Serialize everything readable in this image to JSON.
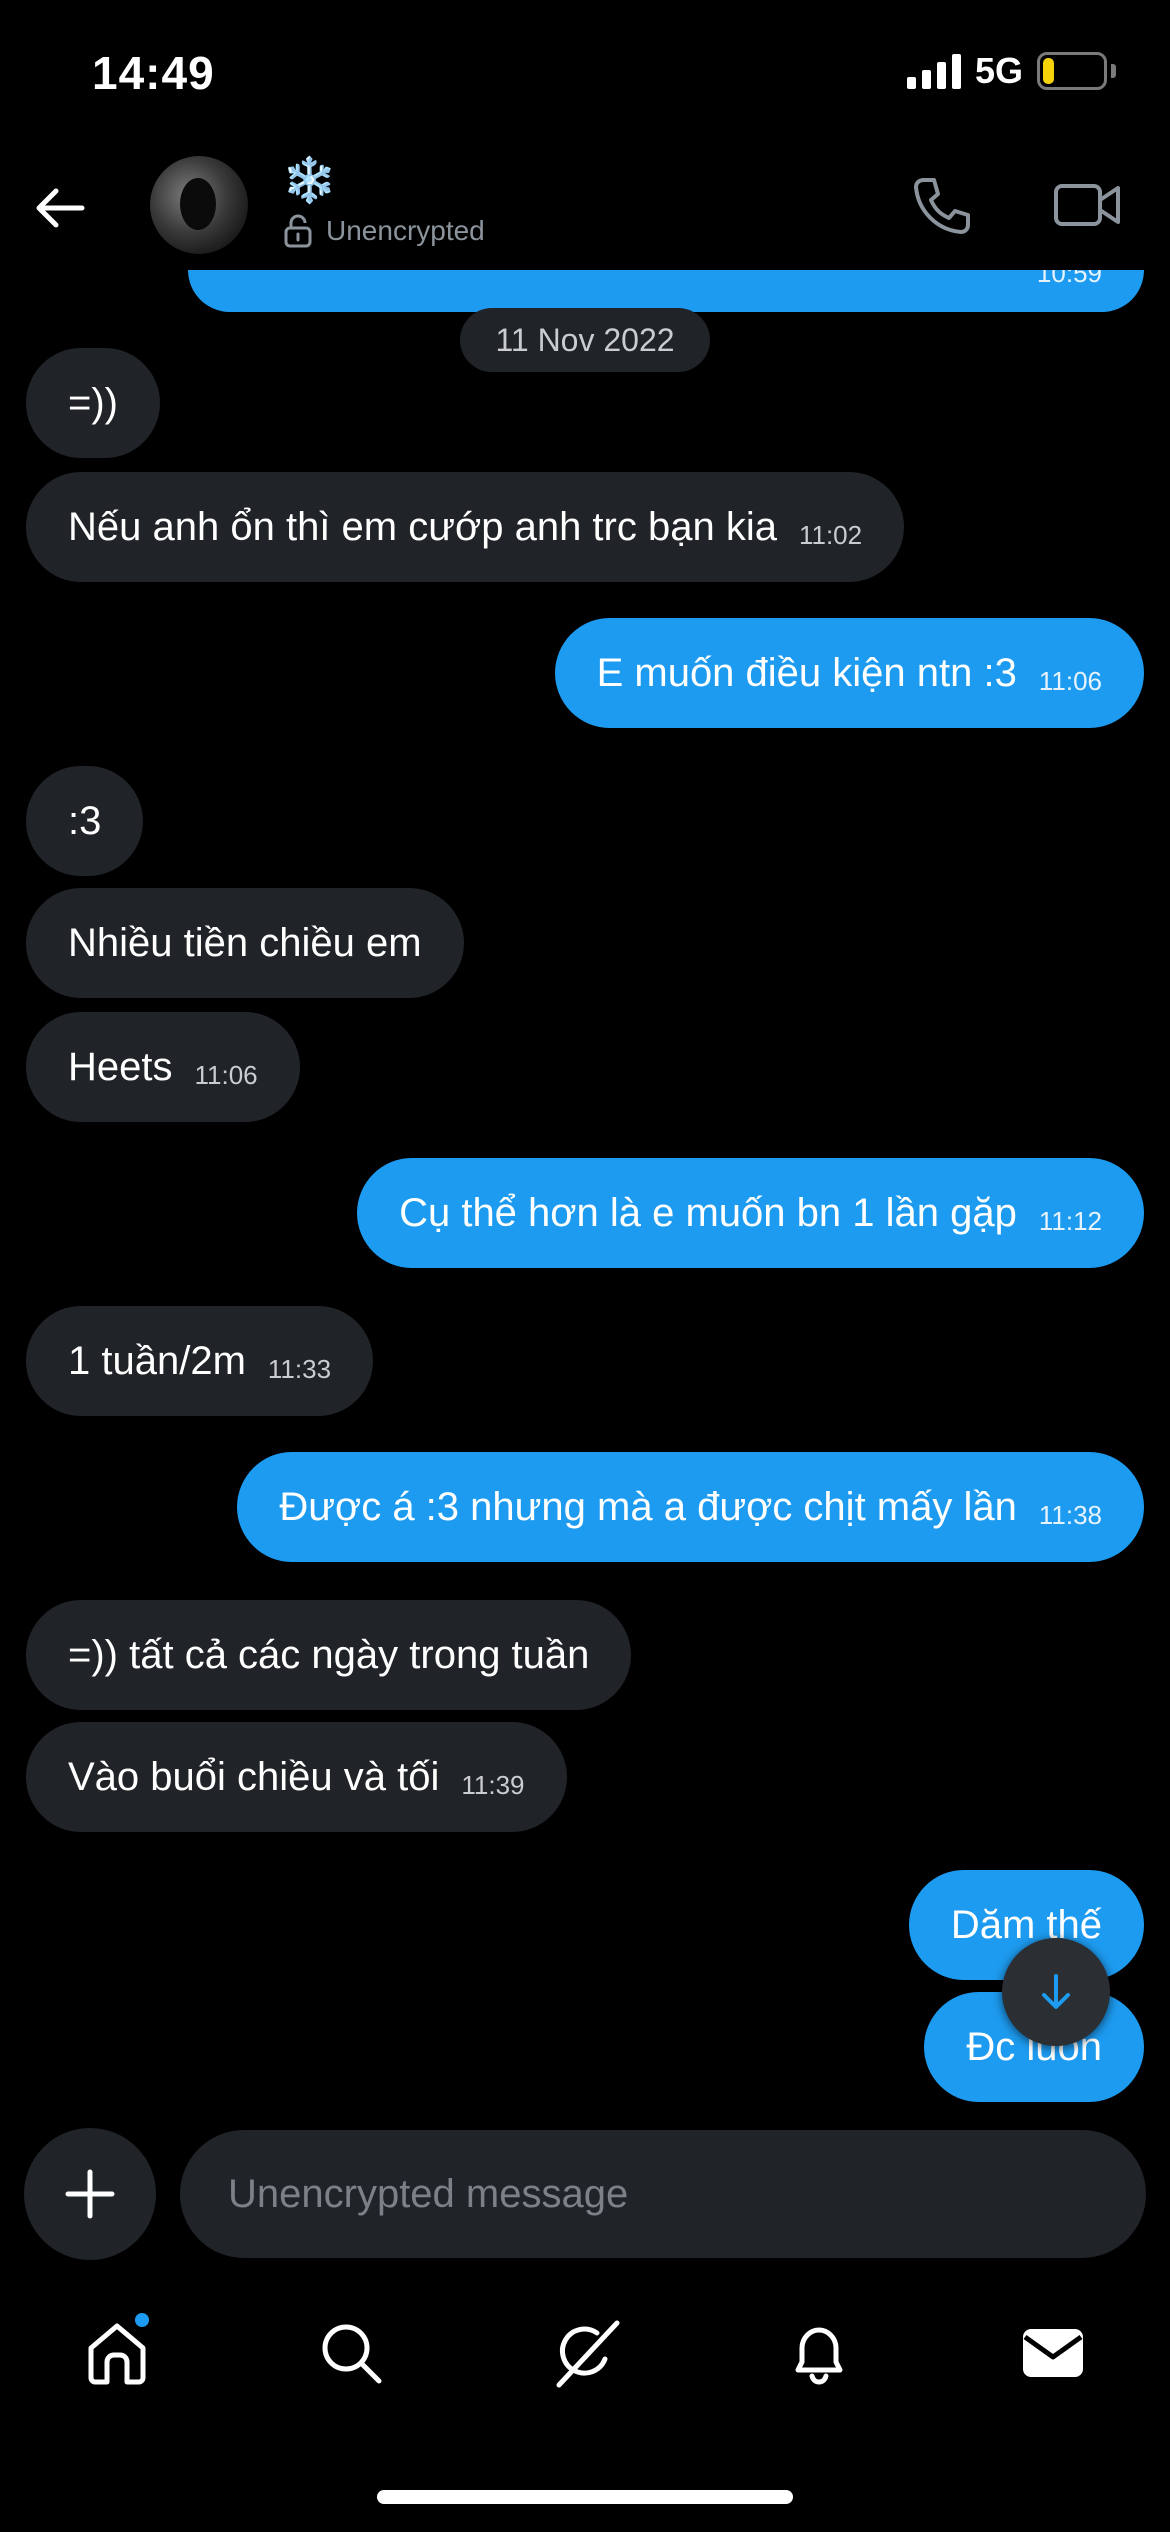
{
  "status_bar": {
    "time": "14:49",
    "network": "5G",
    "battery": "19",
    "battery_level": 0.19
  },
  "header": {
    "contact_name": "❄️",
    "encryption_status": "Unencrypted"
  },
  "top_partial_time": "10:59",
  "date_separator": "11 Nov 2022",
  "messages": [
    {
      "dir": "in",
      "text": "=))",
      "time": ""
    },
    {
      "dir": "in",
      "text": "Nếu anh ổn thì em cướp anh trc bạn kia",
      "time": "11:02"
    },
    {
      "dir": "out",
      "text": "E muốn điều kiện ntn :3",
      "time": "11:06"
    },
    {
      "dir": "in",
      "text": ":3",
      "time": ""
    },
    {
      "dir": "in",
      "text": "Nhiều tiền chiều em",
      "time": ""
    },
    {
      "dir": "in",
      "text": "Heets",
      "time": "11:06"
    },
    {
      "dir": "out",
      "text": "Cụ thể hơn là e muốn bn 1 lần gặp",
      "time": "11:12"
    },
    {
      "dir": "in",
      "text": "1 tuần/2m",
      "time": "11:33"
    },
    {
      "dir": "out",
      "text": "Được á :3 nhưng mà a được chịt mấy lần",
      "time": "11:38"
    },
    {
      "dir": "in",
      "text": "=)) tất cả các ngày trong tuần",
      "time": ""
    },
    {
      "dir": "in",
      "text": "Vào buổi chiều và tối",
      "time": "11:39"
    },
    {
      "dir": "out",
      "text": "Dăm thế",
      "time": ""
    },
    {
      "dir": "out",
      "text": "Đc luôn",
      "time": ""
    }
  ],
  "composer": {
    "placeholder": "Unencrypted message"
  },
  "icons": {
    "back": "arrow-left-icon",
    "call": "phone-icon",
    "video": "video-camera-icon",
    "plus": "plus-icon",
    "scroll": "arrow-down-icon",
    "tabs": [
      "home-icon",
      "search-icon",
      "grok-icon",
      "bell-icon",
      "mail-icon"
    ]
  },
  "colors": {
    "outgoing_bubble": "#1d9bf0",
    "incoming_bubble": "#202327",
    "background": "#000000",
    "battery_fill": "#f5d20a"
  }
}
